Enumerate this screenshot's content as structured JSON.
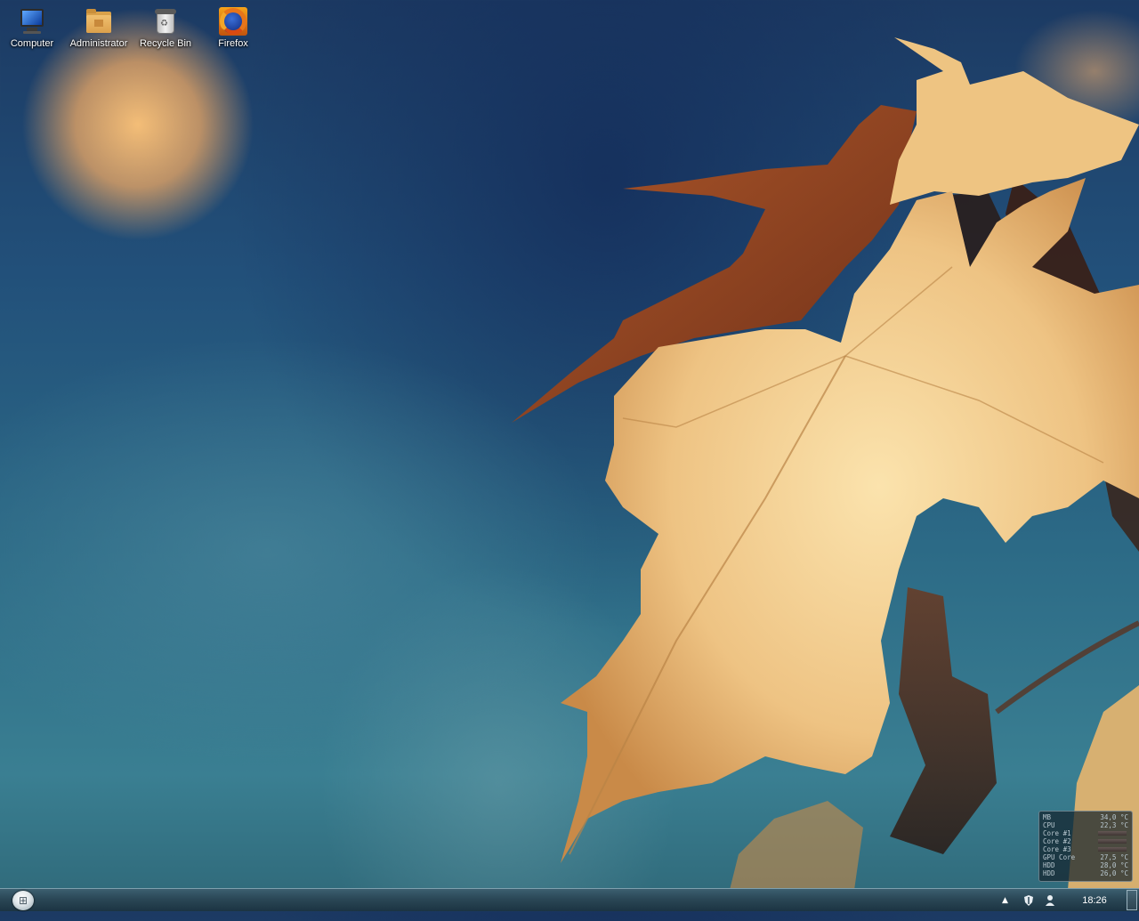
{
  "desktop": {
    "icons": [
      {
        "label": "Computer",
        "icon": "computer-icon"
      },
      {
        "label": "Administrator",
        "icon": "user-folder-icon"
      },
      {
        "label": "Recycle Bin",
        "icon": "recycle-bin-icon"
      },
      {
        "label": "Firefox",
        "icon": "firefox-icon"
      }
    ]
  },
  "gadget": {
    "rows": [
      {
        "label": "MB",
        "value": "34,0 °C"
      },
      {
        "label": "CPU",
        "value": "22,3 °C"
      },
      {
        "label": "Core #1",
        "value": ""
      },
      {
        "label": "Core #2",
        "value": ""
      },
      {
        "label": "Core #3",
        "value": ""
      },
      {
        "label": "GPU Core",
        "value": "27,5 °C"
      },
      {
        "label": "HDD",
        "value": "28,0 °C"
      },
      {
        "label": "HDD",
        "value": "26,0 °C"
      }
    ]
  },
  "taskbar": {
    "clock": "18:26",
    "tray_expand": "▲"
  },
  "colors": {
    "taskbar": "#2a4756",
    "leaf_light": "#f2cf8e",
    "leaf_rust": "#9a4a22"
  }
}
